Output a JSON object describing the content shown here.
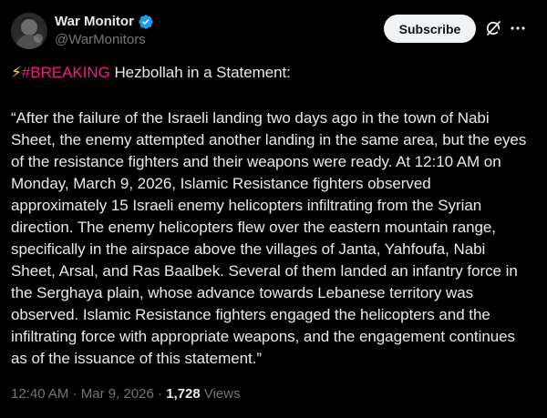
{
  "author": {
    "display_name": "War Monitor",
    "handle": "@WarMonitors",
    "verified_color": "#1d9bf0"
  },
  "actions": {
    "subscribe_label": "Subscribe"
  },
  "post": {
    "headline_emoji": "⚡",
    "headline_hashtag": "#BREAKING",
    "headline_rest": " Hezbollah in a Statement:",
    "body": "“After the failure of the Israeli landing two days ago in the town of Nabi Sheet, the enemy attempted another landing in the same area, but the eyes of the resistance fighters and their weapons were ready. At 12:10 AM on Monday, March 9, 2026, Islamic Resistance fighters observed approximately 15 Israeli enemy helicopters infiltrating from the Syrian direction. The enemy helicopters flew over the eastern mountain range, specifically in the airspace above the villages of Janta, Yahfoufa, Nabi Sheet, Arsal, and Ras Baalbek. Several of them landed an infantry force in the Serghaya plain, whose advance towards Lebanese territory was observed. Islamic Resistance fighters engaged the helicopters and the infiltrating force with appropriate weapons, and the engagement continues as of the issuance of this statement.”"
  },
  "meta": {
    "time": "12:40 AM",
    "separator1": " · ",
    "date": "Mar 9, 2026",
    "separator2": " · ",
    "views_count": "1,728",
    "views_label": " Views"
  },
  "colors": {
    "background": "#000000",
    "text": "#e7e9ea",
    "muted": "#71767b",
    "hashtag": "#f91880",
    "bolt": "#ffd43b"
  }
}
